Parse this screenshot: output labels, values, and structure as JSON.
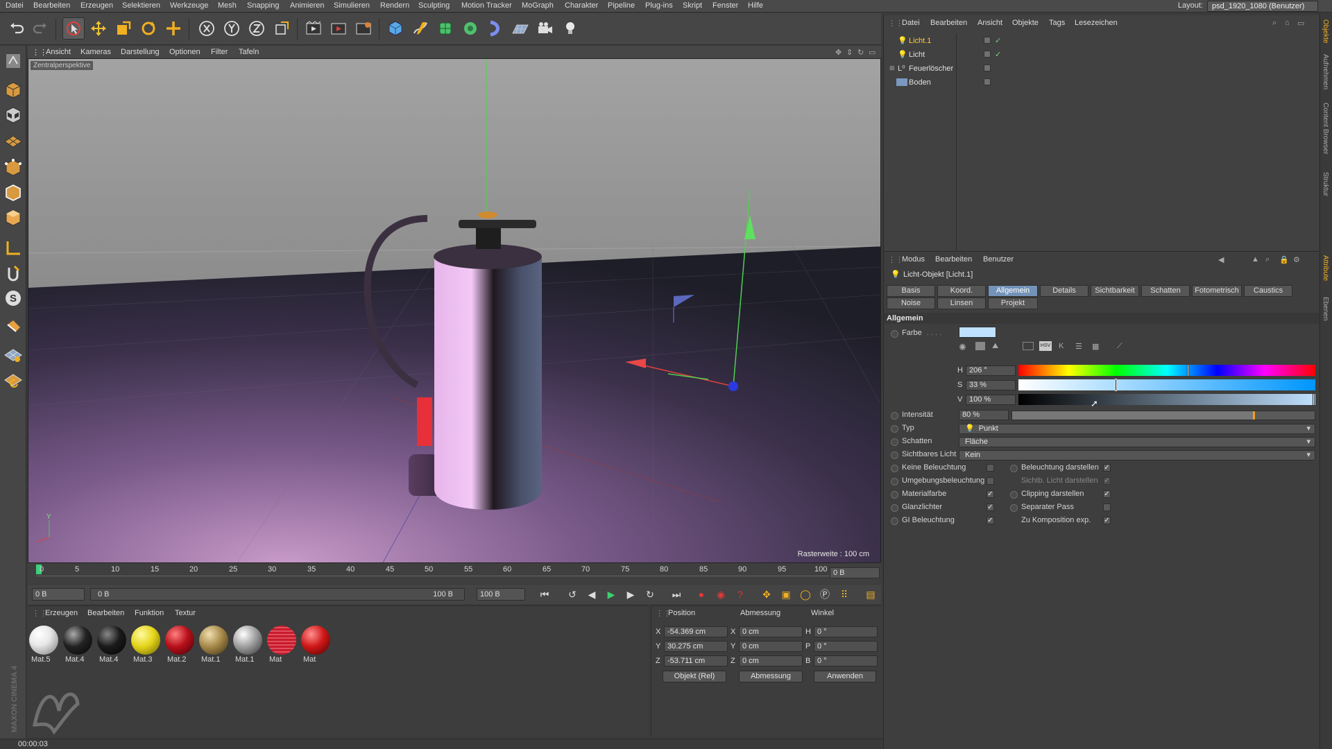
{
  "menubar": {
    "items": [
      "Datei",
      "Bearbeiten",
      "Erzeugen",
      "Selektieren",
      "Werkzeuge",
      "Mesh",
      "Snapping",
      "Animieren",
      "Simulieren",
      "Rendern",
      "Sculpting",
      "Motion Tracker",
      "MoGraph",
      "Charakter",
      "Pipeline",
      "Plug-ins",
      "Skript",
      "Fenster",
      "Hilfe"
    ],
    "layout_label": "Layout:",
    "layout_value": "psd_1920_1080 (Benutzer)"
  },
  "viewport": {
    "menu": [
      "Ansicht",
      "Kameras",
      "Darstellung",
      "Optionen",
      "Filter",
      "Tafeln"
    ],
    "camera_label": "Zentralperspektive",
    "grid_label": "Rasterweite : 100 cm"
  },
  "timeline": {
    "ticks": [
      "0",
      "5",
      "10",
      "15",
      "20",
      "25",
      "30",
      "35",
      "40",
      "45",
      "50",
      "55",
      "60",
      "65",
      "70",
      "75",
      "80",
      "85",
      "90",
      "95",
      "100"
    ],
    "current_frame": "0 B",
    "start_field": "0 B",
    "range_start": "0 B",
    "range_end": "100 B",
    "end_field": "100 B"
  },
  "materials": {
    "menu": [
      "Erzeugen",
      "Bearbeiten",
      "Funktion",
      "Textur"
    ],
    "items": [
      {
        "label": "Mat.5",
        "color": "#e8e8e8"
      },
      {
        "label": "Mat.4",
        "color": "#222222"
      },
      {
        "label": "Mat.4",
        "color": "#1a1a1a"
      },
      {
        "label": "Mat.3",
        "color": "#e4d51a"
      },
      {
        "label": "Mat.2",
        "color": "#b8101a"
      },
      {
        "label": "Mat.1",
        "color": "#a88a4a"
      },
      {
        "label": "Mat.1",
        "color": "#a0a0a0"
      },
      {
        "label": "Mat",
        "color": "#c81c2c"
      },
      {
        "label": "Mat",
        "color": "#d01818"
      }
    ],
    "brand": "MAXON CINEMA 4D"
  },
  "coordinates": {
    "headers": [
      "Position",
      "Abmessung",
      "Winkel"
    ],
    "rows": [
      {
        "axis": "X",
        "pos": "-54.369 cm",
        "dim_axis": "X",
        "dim": "0 cm",
        "ang_axis": "H",
        "ang": "0 °"
      },
      {
        "axis": "Y",
        "pos": "30.275 cm",
        "dim_axis": "Y",
        "dim": "0 cm",
        "ang_axis": "P",
        "ang": "0 °"
      },
      {
        "axis": "Z",
        "pos": "-53.711 cm",
        "dim_axis": "Z",
        "dim": "0 cm",
        "ang_axis": "B",
        "ang": "0 °"
      }
    ],
    "mode_select": "Objekt (Rel)",
    "dim_select": "Abmessung",
    "apply_button": "Anwenden"
  },
  "status": {
    "time": "00:00:03"
  },
  "object_manager": {
    "menu": [
      "Datei",
      "Bearbeiten",
      "Ansicht",
      "Objekte",
      "Tags",
      "Lesezeichen"
    ],
    "objects": [
      {
        "name": "Licht.1",
        "selected": true
      },
      {
        "name": "Licht",
        "selected": false
      },
      {
        "name": "Feuerlöscher",
        "selected": false
      },
      {
        "name": "Boden",
        "selected": false
      }
    ]
  },
  "right_strip": {
    "tabs": [
      "Objekte",
      "Aufnehmen",
      "Content Browser",
      "Struktur",
      "Attribute",
      "Ebenen"
    ]
  },
  "attributes": {
    "menu": [
      "Modus",
      "Bearbeiten",
      "Benutzer"
    ],
    "object_title": "Licht-Objekt [Licht.1]",
    "tabs_row1": [
      "Basis",
      "Koord.",
      "Allgemein",
      "Details",
      "Sichtbarkeit",
      "Schatten",
      "Fotometrisch",
      "Caustics"
    ],
    "tabs_row2": [
      "Noise",
      "Linsen",
      "Projekt"
    ],
    "active_tab": "Allgemein",
    "section": "Allgemein",
    "color_label": "Farbe",
    "color_value": "#bfe0ff",
    "h_label": "H",
    "h_value": "206 °",
    "h_fraction": 0.572,
    "s_label": "S",
    "s_value": "33 %",
    "s_fraction": 0.33,
    "v_label": "V",
    "v_value": "100 %",
    "v_fraction": 1.0,
    "intensity_label": "Intensität",
    "intensity_value": "80 %",
    "intensity_fraction": 0.8,
    "type_label": "Typ",
    "type_value": "Punkt",
    "shadow_label": "Schatten",
    "shadow_value": "Fläche",
    "visible_label": "Sichtbares Licht",
    "visible_value": "Kein",
    "options_left": [
      {
        "label": "Keine Beleuchtung",
        "checked": false
      },
      {
        "label": "Umgebungsbeleuchtung",
        "checked": false
      },
      {
        "label": "Materialfarbe",
        "checked": true
      },
      {
        "label": "Glanzlichter",
        "checked": true
      },
      {
        "label": "GI Beleuchtung",
        "checked": true
      }
    ],
    "options_right": [
      {
        "label": "Beleuchtung darstellen",
        "checked": true
      },
      {
        "label": "Sichtb. Licht darstellen",
        "checked": true
      },
      {
        "label": "Clipping darstellen",
        "checked": true
      },
      {
        "label": "Separater Pass",
        "checked": false
      },
      {
        "label": "Zu Komposition exp.",
        "checked": true
      }
    ]
  }
}
